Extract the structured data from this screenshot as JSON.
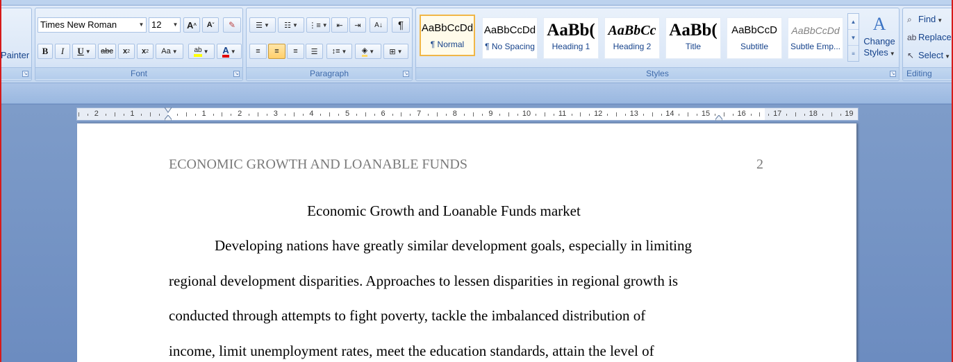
{
  "ribbon": {
    "clipboard": {
      "format_painter_label": "Painter"
    },
    "font": {
      "group_label": "Font",
      "font_name": "Times New Roman",
      "font_size": "12",
      "grow_label": "A",
      "shrink_label": "A",
      "bold_label": "B",
      "italic_label": "I",
      "underline_label": "U",
      "strike_label": "abc",
      "subscript_label": "x",
      "superscript_label": "x",
      "case_label": "Aa",
      "highlight_label": "ab",
      "font_color_label": "A",
      "highlight_color": "#ffff00",
      "font_color": "#e00000"
    },
    "paragraph": {
      "group_label": "Paragraph",
      "pilcrow_label": "¶"
    },
    "styles": {
      "group_label": "Styles",
      "tiles": [
        {
          "preview": "AaBbCcDd",
          "name": "¶ Normal"
        },
        {
          "preview": "AaBbCcDd",
          "name": "¶ No Spacing"
        },
        {
          "preview": "AaBb(",
          "name": "Heading 1"
        },
        {
          "preview": "AaBbCc",
          "name": "Heading 2"
        },
        {
          "preview": "AaBb(",
          "name": "Title"
        },
        {
          "preview": "AaBbCcD",
          "name": "Subtitle"
        },
        {
          "preview": "AaBbCcDd",
          "name": "Subtle Emp..."
        }
      ],
      "change_styles_line1": "Change",
      "change_styles_line2": "Styles"
    },
    "editing": {
      "group_label": "Editing",
      "find_label": "Find",
      "replace_label": "Replace",
      "select_label": "Select"
    }
  },
  "ruler": {
    "numbers": [
      "2",
      "1",
      "1",
      "2",
      "3",
      "4",
      "5",
      "6",
      "7",
      "8",
      "9",
      "10",
      "11",
      "12",
      "13",
      "14",
      "15",
      "16",
      "17",
      "18",
      "19"
    ]
  },
  "document": {
    "running_head": "ECONOMIC GROWTH AND LOANABLE FUNDS",
    "page_number": "2",
    "title": "Economic Growth and Loanable Funds market",
    "lines": [
      "Developing nations have greatly similar development goals, especially in limiting",
      "regional development disparities. Approaches to lessen disparities in regional growth is",
      "conducted through attempts to fight poverty, tackle the imbalanced distribution of",
      "income, limit unemployment rates, meet the education standards, attain the level of"
    ]
  }
}
